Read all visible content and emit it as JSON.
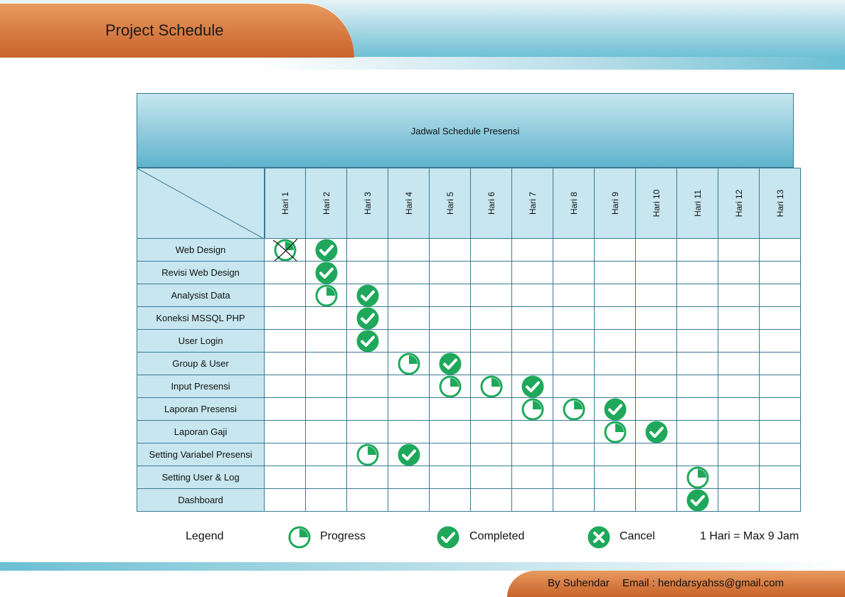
{
  "page": {
    "title": "Project Schedule",
    "footer_author": "By Suhendar",
    "footer_email": "Email : hendarsyahss@gmail.com"
  },
  "schedule": {
    "title": "Jadwal Schedule Presensi",
    "days": [
      "Hari 1",
      "Hari 2",
      "Hari 3",
      "Hari 4",
      "Hari 5",
      "Hari 6",
      "Hari 7",
      "Hari 8",
      "Hari 9",
      "Hari 10",
      "Hari 11",
      "Hari 12",
      "Hari 13"
    ],
    "tasks": [
      {
        "name": "Web Design",
        "marks": [
          {
            "day": 1,
            "status": "cancel-drawn"
          },
          {
            "day": 2,
            "status": "completed"
          }
        ]
      },
      {
        "name": "Revisi Web Design",
        "marks": [
          {
            "day": 2,
            "status": "completed"
          }
        ]
      },
      {
        "name": "Analysist Data",
        "marks": [
          {
            "day": 2,
            "status": "progress"
          },
          {
            "day": 3,
            "status": "completed"
          }
        ]
      },
      {
        "name": "Koneksi MSSQL PHP",
        "marks": [
          {
            "day": 3,
            "status": "completed"
          }
        ]
      },
      {
        "name": "User Login",
        "marks": [
          {
            "day": 3,
            "status": "completed"
          }
        ]
      },
      {
        "name": "Group & User",
        "marks": [
          {
            "day": 4,
            "status": "progress"
          },
          {
            "day": 5,
            "status": "completed"
          }
        ]
      },
      {
        "name": "Input Presensi",
        "marks": [
          {
            "day": 5,
            "status": "progress"
          },
          {
            "day": 6,
            "status": "progress"
          },
          {
            "day": 7,
            "status": "completed"
          }
        ]
      },
      {
        "name": "Laporan Presensi",
        "marks": [
          {
            "day": 7,
            "status": "progress"
          },
          {
            "day": 8,
            "status": "progress"
          },
          {
            "day": 9,
            "status": "completed"
          }
        ]
      },
      {
        "name": "Laporan Gaji",
        "marks": [
          {
            "day": 9,
            "status": "progress"
          },
          {
            "day": 10,
            "status": "completed"
          }
        ]
      },
      {
        "name": "Setting Variabel Presensi",
        "marks": [
          {
            "day": 3,
            "status": "progress"
          },
          {
            "day": 4,
            "status": "completed"
          }
        ]
      },
      {
        "name": "Setting User & Log",
        "marks": [
          {
            "day": 11,
            "status": "progress"
          }
        ]
      },
      {
        "name": "Dashboard",
        "marks": [
          {
            "day": 11,
            "status": "completed"
          }
        ]
      }
    ]
  },
  "legend": {
    "title": "Legend",
    "items": [
      {
        "status": "progress",
        "label": "Progress"
      },
      {
        "status": "completed",
        "label": "Completed"
      },
      {
        "status": "cancel",
        "label": "Cancel"
      }
    ],
    "note": "1 Hari = Max 9 Jam"
  },
  "colors": {
    "accent_orange": "#c8622a",
    "accent_blue": "#5eb3cc",
    "icon_green": "#1fa85b"
  }
}
